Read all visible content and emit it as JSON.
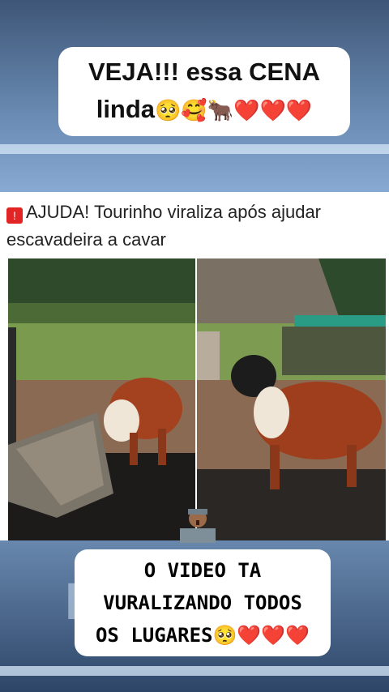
{
  "top_caption": {
    "line1": "VEJA!!! essa CENA",
    "line2_text": "linda",
    "line2_emojis": "🥺🥰🐂",
    "hearts": "❤️❤️❤️"
  },
  "post": {
    "alert_icon": "siren-alert-icon",
    "headline": "AJUDA! Tourinho viraliza após ajudar escavadeira a cavar"
  },
  "bottom_caption": {
    "line1": "O VIDEO TA",
    "line2": "VURALIZANDO TODOS",
    "line3_text": "OS LUGARES",
    "line3_emoji": "🥺",
    "hearts": "❤️❤️❤️"
  },
  "colors": {
    "caption_bg": "#ffffff",
    "heart": "#e0192b",
    "background_blue": "#7fa0c8"
  }
}
